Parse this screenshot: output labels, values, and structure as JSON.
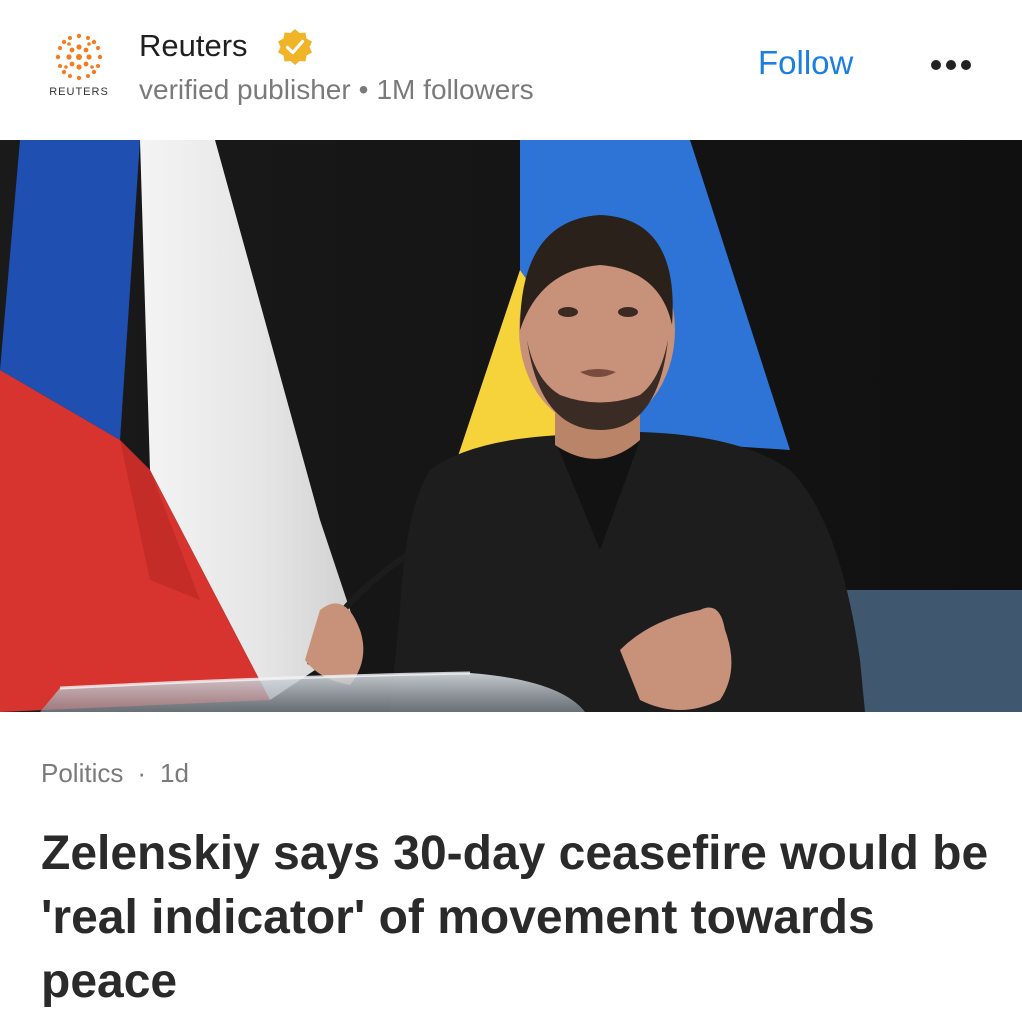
{
  "publisher": {
    "logo_text": "REUTERS",
    "name": "Reuters",
    "badge_icon": "verified-check-icon",
    "subtitle": "verified publisher",
    "separator": "•",
    "followers": "1M followers",
    "follow_label": "Follow",
    "more_icon": "more-horizontal-icon",
    "logo_color": "#f47b20",
    "badge_color": "#f0b429",
    "follow_color": "#1a7fe0"
  },
  "article": {
    "category": "Politics",
    "separator": "·",
    "age": "1d",
    "headline": "Zelenskiy says 30-day ceasefire would be 'real indicator' of movement towards peace"
  }
}
